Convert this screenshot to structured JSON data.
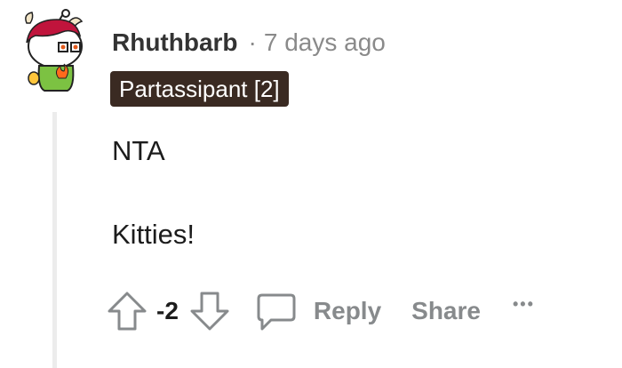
{
  "comment": {
    "author": "Rhuthbarb",
    "separator": "·",
    "timestamp": "7 days ago",
    "flair": "Partassipant [2]",
    "body_lines": [
      "NTA",
      "Kitties!"
    ]
  },
  "actions": {
    "vote_count": "-2",
    "reply_label": "Reply",
    "share_label": "Share",
    "more_label": "•••"
  },
  "icons": {
    "avatar": "snoo-avatar",
    "upvote": "arrow-up-icon",
    "downvote": "arrow-down-icon",
    "reply": "speech-bubble-icon",
    "more": "ellipsis-icon"
  },
  "colors": {
    "flair_background": "#3a2a22",
    "flair_text": "#ffffff",
    "muted_text": "#878a8c",
    "thread_line": "#ececec"
  }
}
